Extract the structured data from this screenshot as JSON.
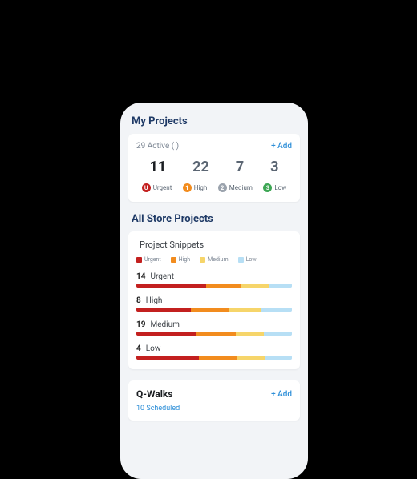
{
  "sections": {
    "my_projects_title": "My Projects",
    "all_store_title": "All Store Projects",
    "snippets_label": "Project Snippets"
  },
  "my_projects": {
    "active_text": "29 Active ( )",
    "add_label": "+ Add",
    "counts": {
      "urgent": "11",
      "high": "22",
      "medium": "7",
      "low": "3"
    },
    "labels": {
      "urgent": "Urgent",
      "high": "High",
      "medium": "Medium",
      "low": "Low"
    },
    "badges": {
      "urgent": "U",
      "high": "1",
      "medium": "2",
      "low": "3"
    }
  },
  "legend": {
    "urgent": "Urgent",
    "high": "High",
    "medium": "Medium",
    "low": "Low"
  },
  "bars": {
    "urgent": {
      "count": "14",
      "label": "Urgent"
    },
    "high": {
      "count": "8",
      "label": "High"
    },
    "medium": {
      "count": "19",
      "label": "Medium"
    },
    "low": {
      "count": "4",
      "label": "Low"
    }
  },
  "qwalks": {
    "title": "Q-Walks",
    "add_label": "+ Add",
    "scheduled": "10 Scheduled"
  },
  "colors": {
    "urgent": "#c3201f",
    "high": "#f28c1e",
    "medium": "#f6d56a",
    "low": "#b7dff5"
  }
}
